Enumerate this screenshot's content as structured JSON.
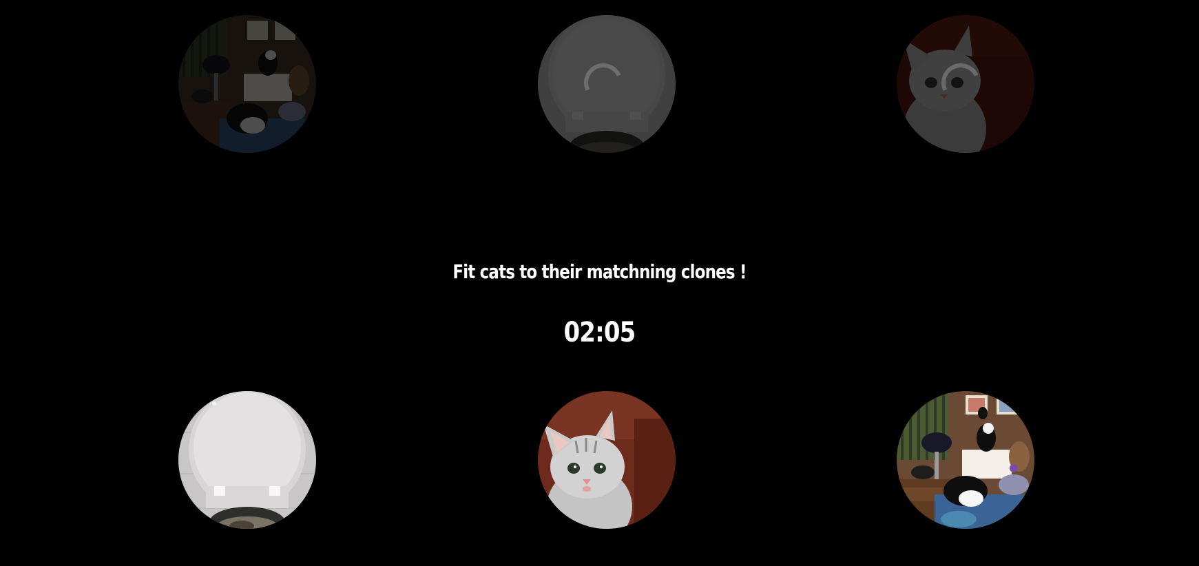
{
  "game": {
    "instruction": "Fit cats to their matchning clones !",
    "timer": "02:05"
  },
  "targets": [
    {
      "image": "cats-in-bedroom-image",
      "state": "faded"
    },
    {
      "image": "toilet-seat-image",
      "state": "faded-loading"
    },
    {
      "image": "kitten-image",
      "state": "faded-loading"
    }
  ],
  "pieces": [
    {
      "image": "toilet-seat-image"
    },
    {
      "image": "kitten-image"
    },
    {
      "image": "cats-in-bedroom-image"
    }
  ],
  "colors": {
    "background": "#000000",
    "text": "#ffffff"
  }
}
